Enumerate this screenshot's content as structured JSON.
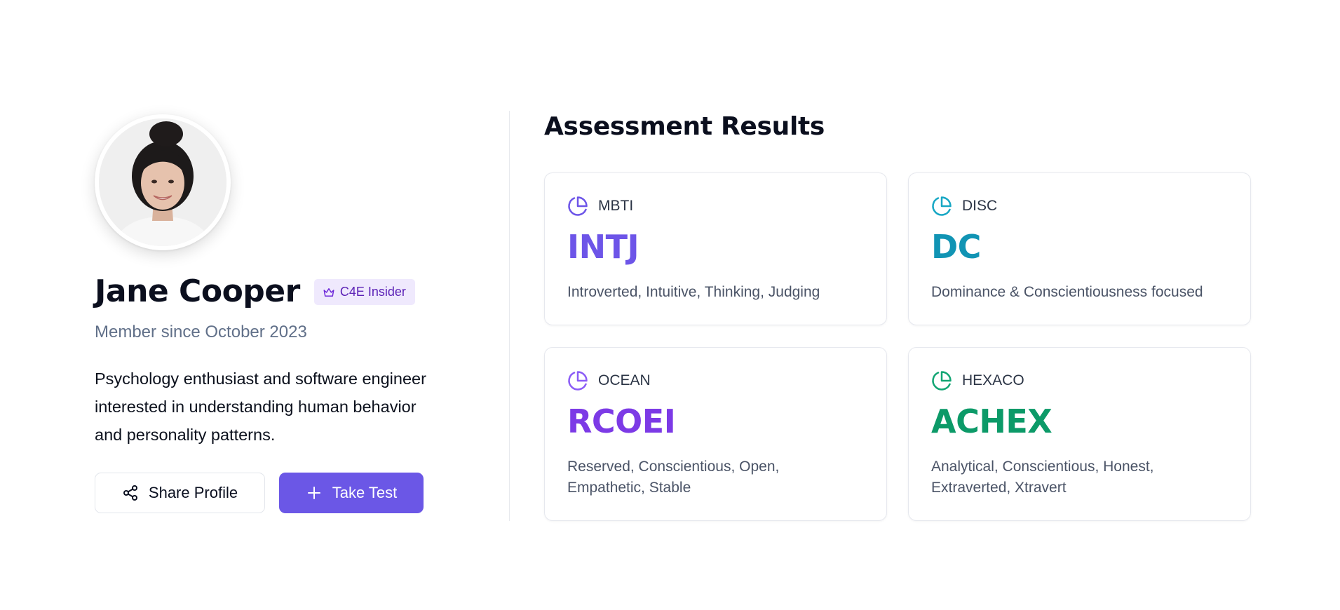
{
  "profile": {
    "name": "Jane Cooper",
    "badge_label": "C4E Insider",
    "member_since": "Member since October 2023",
    "bio": "Psychology enthusiast and software engineer interested in understanding human behavior and personality patterns.",
    "share_label": "Share Profile",
    "take_test_label": "Take Test"
  },
  "results": {
    "title": "Assessment Results",
    "cards": [
      {
        "label": "MBTI",
        "code": "INTJ",
        "description": "Introverted, Intuitive, Thinking, Judging",
        "color": "#6d55e8",
        "icon": "pie-chart-icon"
      },
      {
        "label": "DISC",
        "code": "DC",
        "description": "Dominance & Conscientiousness focused",
        "color": "#1194b4",
        "icon": "pie-chart-icon"
      },
      {
        "label": "OCEAN",
        "code": "RCOEI",
        "description": "Reserved, Conscientious, Open, Empathetic, Stable",
        "color": "#7c3ae6",
        "icon": "pie-chart-icon"
      },
      {
        "label": "HEXACO",
        "code": "ACHEX",
        "description": "Analytical, Conscientious, Honest, Extraverted, Xtravert",
        "color": "#0c9a68",
        "icon": "pie-chart-icon"
      }
    ]
  },
  "colors": {
    "accent": "#6b57e6",
    "badge_bg": "#efe9fd",
    "badge_text": "#5b21b6",
    "muted": "#617089"
  }
}
